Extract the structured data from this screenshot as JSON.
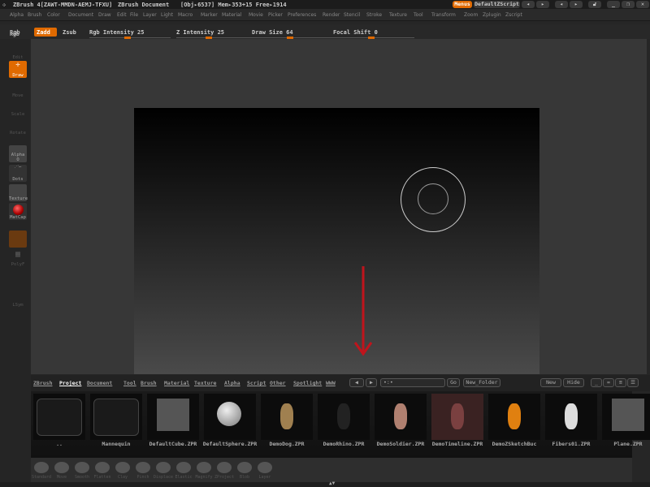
{
  "titlebar": {
    "app": "ZBrush 4[ZAWT-MMDN-AEMJ-TFXU]",
    "document": "ZBrush Document",
    "stats": "[Obj▸6537] Mem▸353+15 Free▸1914",
    "menus": "Menus",
    "script": "DefaultZScript"
  },
  "menubar": [
    "Alpha",
    "Brush",
    "Color",
    "Document",
    "Draw",
    "Edit",
    "File",
    "Layer",
    "Light",
    "Macro",
    "Marker",
    "Material",
    "Movie",
    "Picker",
    "Preferences",
    "Render",
    "Stencil",
    "Stroke",
    "Texture",
    "Tool",
    "Transform",
    "Zoom",
    "Zplugin",
    "Zscript"
  ],
  "topshelf": {
    "rgb": "Rgb",
    "zadd": "Zadd",
    "zsub": "Zsub",
    "rgb_intensity": "Rgb Intensity 25",
    "z_intensity": "Z Intensity 25",
    "draw_size": "Draw Size 64",
    "focal_shift": "Focal Shift 0",
    "accent": "#e06a00"
  },
  "leftshelf": {
    "rgb": "Rgb",
    "edit": "Edit",
    "draw": "Draw",
    "move": "Move",
    "scale": "Scale",
    "rotate": "Rotate",
    "alpha": "Alpha O",
    "dots": "Dots",
    "texture": "Texture",
    "matcap": "MatCap",
    "polyf": "PolyF",
    "lsym": "LSym"
  },
  "lightbox": {
    "tabs": [
      "ZBrush",
      "Project",
      "Document",
      "Tool",
      "Brush",
      "Material",
      "Texture",
      "Alpha",
      "Script",
      "Other",
      "Spotlight",
      "WWW"
    ],
    "active_tab": "Project",
    "path": "•:•",
    "go": "Go",
    "new_folder": "New_Folder",
    "new": "New",
    "hide": "Hide",
    "items": [
      "..",
      "Mannequin",
      "DefaultCube.ZPR",
      "DefaultSphere.ZPR",
      "DemoDog.ZPR",
      "DemoRhino.ZPR",
      "DemoSoldier.ZPR",
      "DemoTimeline.ZPR",
      "DemoZSketchBuc",
      "Fibers01.ZPR",
      "Plane.ZPR"
    ]
  },
  "brushes": [
    "Standard",
    "Move",
    "Smooth",
    "Flatten",
    "Clay",
    "Pinch",
    "Displace",
    "Elastic",
    "Magnify",
    "ZProject",
    "Blob",
    "Layer"
  ],
  "annotation": {
    "arrow_color": "#c0141c",
    "arrow_direction": "down"
  }
}
